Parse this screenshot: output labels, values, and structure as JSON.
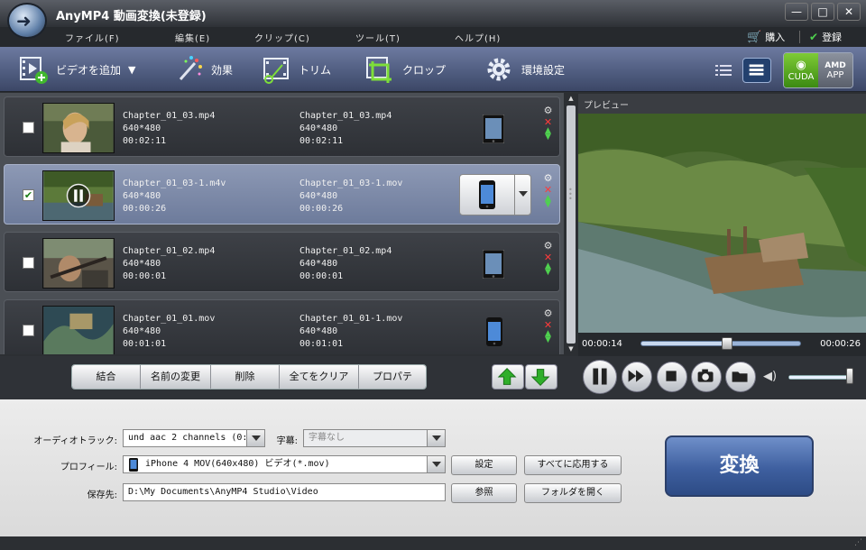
{
  "window": {
    "title": "AnyMP4 動画変換(未登録)",
    "min": "—",
    "max": "□",
    "close": "✕"
  },
  "menu": {
    "items": [
      "ファイル(F)",
      "編集(E)",
      "クリップ(C)",
      "ツール(T)",
      "ヘルプ(H)"
    ],
    "buy": "購入",
    "register": "登録"
  },
  "toolbar": {
    "add_video": "ビデオを追加",
    "effects": "効果",
    "trim": "トリム",
    "crop": "クロップ",
    "settings": "環境設定",
    "gpu_cuda": "CUDA",
    "gpu_amd_top": "AMD",
    "gpu_amd": "APP"
  },
  "files": [
    {
      "checked": "",
      "src_name": "Chapter_01_03.mp4",
      "src_res": "640*480",
      "src_dur": "00:02:11",
      "out_name": "Chapter_01_03.mp4",
      "out_res": "640*480",
      "out_dur": "00:02:11",
      "device": "tablet"
    },
    {
      "checked": "✔",
      "src_name": "Chapter_01_03-1.m4v",
      "src_res": "640*480",
      "src_dur": "00:00:26",
      "out_name": "Chapter_01_03-1.mov",
      "out_res": "640*480",
      "out_dur": "00:00:26",
      "device": "phone"
    },
    {
      "checked": "",
      "src_name": "Chapter_01_02.mp4",
      "src_res": "640*480",
      "src_dur": "00:00:01",
      "out_name": "Chapter_01_02.mp4",
      "out_res": "640*480",
      "out_dur": "00:00:01",
      "device": "tablet"
    },
    {
      "checked": "",
      "src_name": "Chapter_01_01.mov",
      "src_res": "640*480",
      "src_dur": "00:01:01",
      "out_name": "Chapter_01_01-1.mov",
      "out_res": "640*480",
      "out_dur": "00:01:01",
      "device": "phone"
    }
  ],
  "preview": {
    "label": "プレビュー",
    "current_time": "00:00:14",
    "total_time": "00:00:26",
    "progress_fraction": 0.54,
    "volume_fraction": 1.0
  },
  "list_actions": {
    "merge": "結合",
    "rename": "名前の変更",
    "delete": "削除",
    "clear_all": "全てをクリア",
    "properties": "プロパティ"
  },
  "settings": {
    "audio_track_label": "オーディオトラック:",
    "audio_track_value": "und aac 2 channels (0:",
    "subtitle_label": "字幕:",
    "subtitle_value": "字幕なし",
    "profile_label": "プロフィール:",
    "profile_value": "iPhone 4 MOV(640x480) ビデオ(*.mov)",
    "settings_btn": "設定",
    "apply_all_btn": "すべてに応用する",
    "save_to_label": "保存先:",
    "save_to_value": "D:\\My Documents\\AnyMP4 Studio\\Video",
    "browse_btn": "参照",
    "open_folder_btn": "フォルダを開く",
    "convert_btn": "変換"
  }
}
